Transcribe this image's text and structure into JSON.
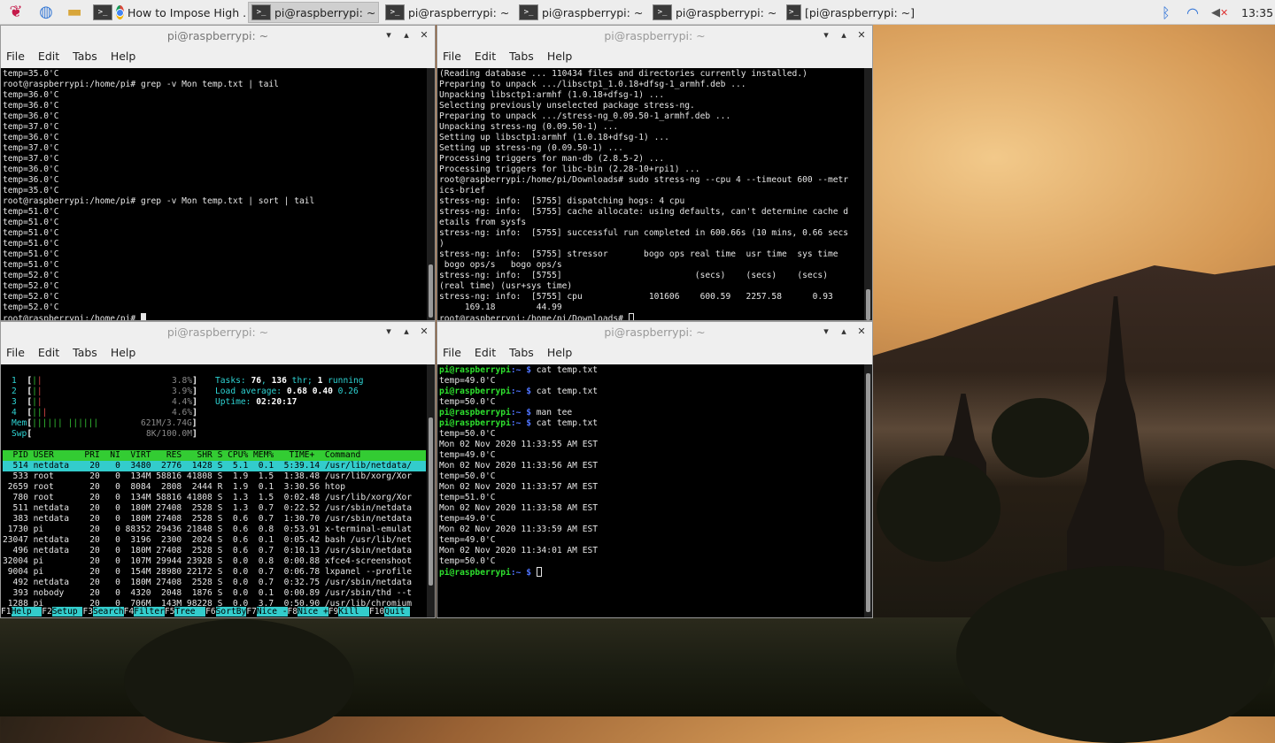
{
  "taskbar": {
    "browser_task": "How to Impose High ...",
    "tasks": [
      "pi@raspberrypi: ~",
      "pi@raspberrypi: ~",
      "pi@raspberrypi: ~",
      "pi@raspberrypi: ~",
      "[pi@raspberrypi: ~]"
    ],
    "clock": "13:35"
  },
  "windows": {
    "top_left": {
      "title": "pi@raspberrypi: ~",
      "menu": [
        "File",
        "Edit",
        "Tabs",
        "Help"
      ],
      "lines": [
        "temp=35.0'C",
        "root@raspberrypi:/home/pi# grep -v Mon temp.txt | tail",
        "temp=36.0'C",
        "temp=36.0'C",
        "temp=36.0'C",
        "temp=37.0'C",
        "temp=36.0'C",
        "temp=37.0'C",
        "temp=37.0'C",
        "temp=36.0'C",
        "temp=36.0'C",
        "temp=35.0'C",
        "root@raspberrypi:/home/pi# grep -v Mon temp.txt | sort | tail",
        "temp=51.0'C",
        "temp=51.0'C",
        "temp=51.0'C",
        "temp=51.0'C",
        "temp=51.0'C",
        "temp=51.0'C",
        "temp=52.0'C",
        "temp=52.0'C",
        "temp=52.0'C",
        "temp=52.0'C"
      ],
      "prompt": "root@raspberrypi:/home/pi# "
    },
    "top_right": {
      "title": "pi@raspberrypi: ~",
      "menu": [
        "File",
        "Edit",
        "Tabs",
        "Help"
      ],
      "lines": [
        "(Reading database ... 110434 files and directories currently installed.)",
        "Preparing to unpack .../libsctp1_1.0.18+dfsg-1_armhf.deb ...",
        "Unpacking libsctp1:armhf (1.0.18+dfsg-1) ...",
        "Selecting previously unselected package stress-ng.",
        "Preparing to unpack .../stress-ng_0.09.50-1_armhf.deb ...",
        "Unpacking stress-ng (0.09.50-1) ...",
        "Setting up libsctp1:armhf (1.0.18+dfsg-1) ...",
        "Setting up stress-ng (0.09.50-1) ...",
        "Processing triggers for man-db (2.8.5-2) ...",
        "Processing triggers for libc-bin (2.28-10+rpi1) ...",
        "root@raspberrypi:/home/pi/Downloads# sudo stress-ng --cpu 4 --timeout 600 --metr",
        "ics-brief",
        "stress-ng: info:  [5755] dispatching hogs: 4 cpu",
        "stress-ng: info:  [5755] cache allocate: using defaults, can't determine cache d",
        "etails from sysfs",
        "stress-ng: info:  [5755] successful run completed in 600.66s (10 mins, 0.66 secs",
        ")",
        "stress-ng: info:  [5755] stressor       bogo ops real time  usr time  sys time",
        " bogo ops/s   bogo ops/s",
        "stress-ng: info:  [5755]                          (secs)    (secs)    (secs)",
        "(real time) (usr+sys time)",
        "stress-ng: info:  [5755] cpu             101606    600.59   2257.58      0.93",
        "     169.18        44.99"
      ],
      "prompt": "root@raspberrypi:/home/pi/Downloads# "
    },
    "bottom_left": {
      "title": "pi@raspberrypi: ~",
      "menu": [
        "File",
        "Edit",
        "Tabs",
        "Help"
      ],
      "htop": {
        "cpus": [
          {
            "n": "1",
            "pct": "3.8%"
          },
          {
            "n": "2",
            "pct": "3.9%"
          },
          {
            "n": "3",
            "pct": "4.4%"
          },
          {
            "n": "4",
            "pct": "4.6%"
          }
        ],
        "mem_label": "Mem",
        "mem_value": "621M/3.74G",
        "swp_label": "Swp",
        "swp_value": "8K/100.0M",
        "tasks_label": "Tasks:",
        "tasks_count": "76",
        "thr_count": "136",
        "thr_label": "thr;",
        "running_count": "1",
        "running_label": "running",
        "load_label": "Load average:",
        "load1": "0.68",
        "load5": "0.40",
        "load15": "0.26",
        "uptime_label": "Uptime:",
        "uptime": "02:20:17",
        "header": "  PID USER      PRI  NI  VIRT   RES   SHR S CPU% MEM%   TIME+  Command",
        "rows": [
          "  514 netdata    20   0  3480  2776  1428 S  5.1  0.1  5:39.14 /usr/lib/netdata/",
          "  533 root       20   0  134M 58816 41808 S  1.9  1.5  1:38.48 /usr/lib/xorg/Xor",
          " 2659 root       20   0  8084  2808  2444 R  1.9  0.1  3:30.56 htop",
          "  780 root       20   0  134M 58816 41808 S  1.3  1.5  0:02.48 /usr/lib/xorg/Xor",
          "  511 netdata    20   0  180M 27408  2528 S  1.3  0.7  0:22.52 /usr/sbin/netdata",
          "  383 netdata    20   0  180M 27408  2528 S  0.6  0.7  1:30.70 /usr/sbin/netdata",
          " 1730 pi         20   0 88352 29436 21848 S  0.6  0.8  0:53.91 x-terminal-emulat",
          "23047 netdata    20   0  3196  2300  2024 S  0.6  0.1  0:05.42 bash /usr/lib/net",
          "  496 netdata    20   0  180M 27408  2528 S  0.6  0.7  0:10.13 /usr/sbin/netdata",
          "32004 pi         20   0  107M 29944 23928 S  0.0  0.8  0:00.88 xfce4-screenshoot",
          " 9004 pi         20   0  154M 28980 22172 S  0.0  0.7  0:06.78 lxpanel --profile",
          "  492 netdata    20   0  180M 27408  2528 S  0.0  0.7  0:32.75 /usr/sbin/netdata",
          "  393 nobody     20   0  4320  2048  1876 S  0.0  0.1  0:00.89 /usr/sbin/thd --t",
          " 1288 pi         20   0  706M  143M 98228 S  0.0  3.7  0:50.90 /usr/lib/chromium"
        ],
        "fkeys": [
          {
            "k": "F1",
            "l": "Help  "
          },
          {
            "k": "F2",
            "l": "Setup "
          },
          {
            "k": "F3",
            "l": "Search"
          },
          {
            "k": "F4",
            "l": "Filter"
          },
          {
            "k": "F5",
            "l": "Tree  "
          },
          {
            "k": "F6",
            "l": "SortBy"
          },
          {
            "k": "F7",
            "l": "Nice -"
          },
          {
            "k": "F8",
            "l": "Nice +"
          },
          {
            "k": "F9",
            "l": "Kill  "
          },
          {
            "k": "F10",
            "l": "Quit "
          }
        ]
      }
    },
    "bottom_right": {
      "title": "pi@raspberrypi: ~",
      "menu": [
        "File",
        "Edit",
        "Tabs",
        "Help"
      ],
      "prompt_user": "pi@raspberrypi",
      "prompt_path": ":~ $",
      "lines": [
        {
          "p": true,
          "t": " cat temp.txt"
        },
        {
          "p": false,
          "t": "temp=49.0'C"
        },
        {
          "p": true,
          "t": " cat temp.txt"
        },
        {
          "p": false,
          "t": "temp=50.0'C"
        },
        {
          "p": true,
          "t": " man tee"
        },
        {
          "p": true,
          "t": " cat temp.txt"
        },
        {
          "p": false,
          "t": "temp=50.0'C"
        },
        {
          "p": false,
          "t": "Mon 02 Nov 2020 11:33:55 AM EST"
        },
        {
          "p": false,
          "t": "temp=49.0'C"
        },
        {
          "p": false,
          "t": "Mon 02 Nov 2020 11:33:56 AM EST"
        },
        {
          "p": false,
          "t": "temp=50.0'C"
        },
        {
          "p": false,
          "t": "Mon 02 Nov 2020 11:33:57 AM EST"
        },
        {
          "p": false,
          "t": "temp=51.0'C"
        },
        {
          "p": false,
          "t": "Mon 02 Nov 2020 11:33:58 AM EST"
        },
        {
          "p": false,
          "t": "temp=49.0'C"
        },
        {
          "p": false,
          "t": "Mon 02 Nov 2020 11:33:59 AM EST"
        },
        {
          "p": false,
          "t": "temp=49.0'C"
        },
        {
          "p": false,
          "t": "Mon 02 Nov 2020 11:34:01 AM EST"
        },
        {
          "p": false,
          "t": "temp=50.0'C"
        },
        {
          "p": true,
          "t": " "
        }
      ]
    }
  }
}
